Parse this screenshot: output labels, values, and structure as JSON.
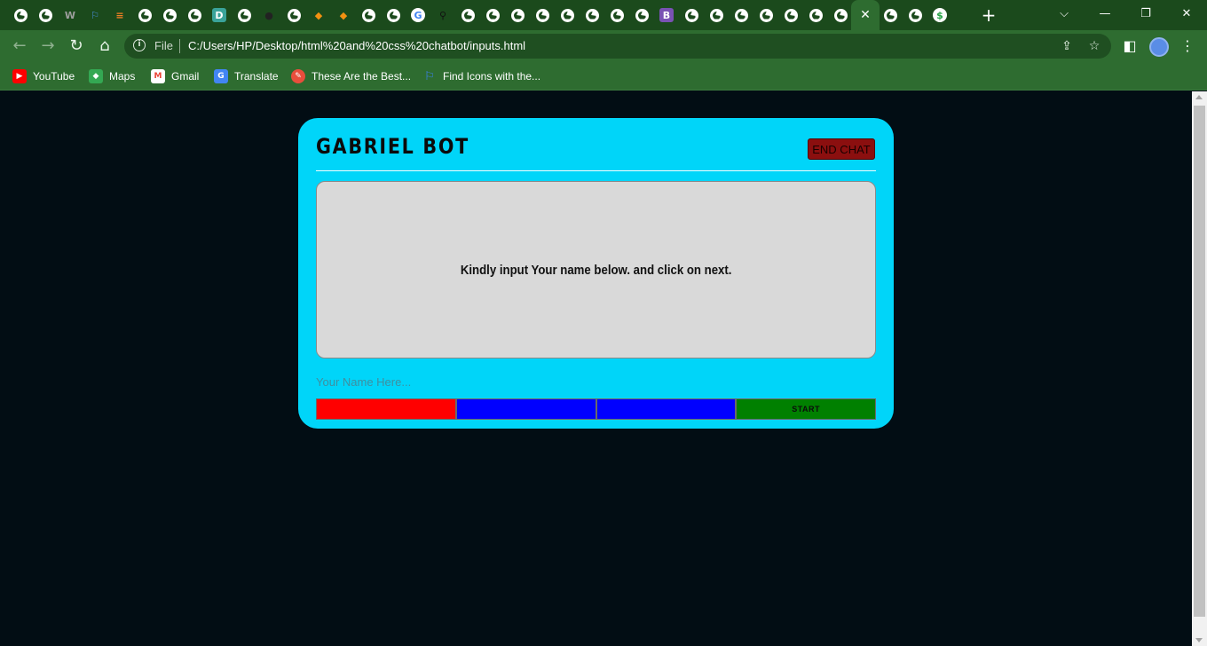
{
  "browser": {
    "tabs": [
      {
        "icon": "globe-icon"
      },
      {
        "icon": "globe-icon"
      },
      {
        "icon": "w-logo-icon",
        "glyph": "W"
      },
      {
        "icon": "flag-icon",
        "glyph": "⚐"
      },
      {
        "icon": "stack-overflow-icon",
        "glyph": "≡"
      },
      {
        "icon": "globe-icon"
      },
      {
        "icon": "globe-icon"
      },
      {
        "icon": "globe-icon"
      },
      {
        "icon": "d-logo-icon",
        "glyph": "D"
      },
      {
        "icon": "globe-icon"
      },
      {
        "icon": "github-icon",
        "glyph": "●"
      },
      {
        "icon": "globe-icon"
      },
      {
        "icon": "diamond-icon",
        "glyph": "◆"
      },
      {
        "icon": "diamond-icon",
        "glyph": "◆"
      },
      {
        "icon": "globe-icon"
      },
      {
        "icon": "globe-icon"
      },
      {
        "icon": "google-icon",
        "glyph": "G"
      },
      {
        "icon": "search-icon",
        "glyph": "⚲"
      },
      {
        "icon": "globe-icon"
      },
      {
        "icon": "globe-icon"
      },
      {
        "icon": "globe-icon"
      },
      {
        "icon": "globe-icon"
      },
      {
        "icon": "globe-icon"
      },
      {
        "icon": "globe-icon"
      },
      {
        "icon": "globe-icon"
      },
      {
        "icon": "globe-icon"
      },
      {
        "icon": "bootstrap-icon",
        "glyph": "B"
      },
      {
        "icon": "globe-icon"
      },
      {
        "icon": "globe-icon"
      },
      {
        "icon": "globe-icon"
      },
      {
        "icon": "globe-icon"
      },
      {
        "icon": "globe-icon"
      },
      {
        "icon": "globe-icon"
      },
      {
        "icon": "globe-icon"
      },
      {
        "icon": "close-icon",
        "active": true,
        "glyph": "✕"
      },
      {
        "icon": "globe-icon"
      },
      {
        "icon": "globe-icon"
      },
      {
        "icon": "dollar-icon",
        "glyph": "$"
      }
    ],
    "address": {
      "scheme_label": "File",
      "url": "C:/Users/HP/Desktop/html%20and%20css%20chatbot/inputs.html"
    },
    "bookmarks": [
      {
        "label": "YouTube",
        "icon": "youtube-icon",
        "color": "#ff0000"
      },
      {
        "label": "Maps",
        "icon": "maps-icon",
        "color": "#34a853"
      },
      {
        "label": "Gmail",
        "icon": "gmail-icon",
        "color": "#ea4335"
      },
      {
        "label": "Translate",
        "icon": "translate-icon",
        "color": "#4285f4"
      },
      {
        "label": "These Are the Best...",
        "icon": "pen-icon",
        "color": "#e94e3c"
      },
      {
        "label": "Find Icons with the...",
        "icon": "flag-icon",
        "color": "#3b82f6"
      }
    ]
  },
  "chatbot": {
    "title": "GABRIEL BOT",
    "end_chat_label": "END CHAT",
    "message": "Kindly input Your name below. and click on next.",
    "name_placeholder": "Your Name Here...",
    "buttons": [
      {
        "label": "",
        "color": "#ff0000"
      },
      {
        "label": "",
        "color": "#0000ff"
      },
      {
        "label": "",
        "color": "#0000ff"
      },
      {
        "label": "START",
        "color": "#008000"
      }
    ]
  },
  "colors": {
    "chrome": "#2e6c30",
    "tabstrip": "#1b4a1c",
    "panel": "#00d5f9",
    "page_bg": "#020d14"
  }
}
